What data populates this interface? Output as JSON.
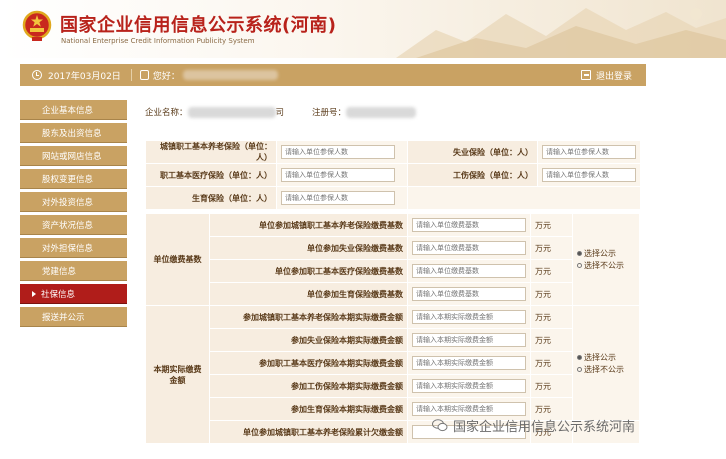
{
  "header": {
    "title": "国家企业信用信息公示系统(河南)",
    "subtitle": "National Enterprise Credit Information Publicity System"
  },
  "topbar": {
    "date": "2017年03月02日",
    "greeting": "您好：",
    "logout_label": "退出登录"
  },
  "sidebar": {
    "items": [
      {
        "label": "企业基本信息",
        "active": false
      },
      {
        "label": "股东及出资信息",
        "active": false
      },
      {
        "label": "网站或网店信息",
        "active": false
      },
      {
        "label": "股权变更信息",
        "active": false
      },
      {
        "label": "对外投资信息",
        "active": false
      },
      {
        "label": "资产状况信息",
        "active": false
      },
      {
        "label": "对外担保信息",
        "active": false
      },
      {
        "label": "党建信息",
        "active": false
      },
      {
        "label": "社保信息",
        "active": true
      },
      {
        "label": "报送并公示",
        "active": false
      }
    ]
  },
  "main": {
    "company_name_label": "企业名称：",
    "company_name_suffix": "司",
    "reg_no_label": "注册号：",
    "insured": {
      "pension_label": "城镇职工基本养老保险（单位：人）",
      "pension_placeholder": "请输入单位参保人数",
      "unemployment_label": "失业保险（单位：人）",
      "unemployment_placeholder": "请输入单位参保人数",
      "medical_label": "职工基本医疗保险（单位：人）",
      "medical_placeholder": "请输入单位参保人数",
      "injury_label": "工伤保险（单位：人）",
      "injury_placeholder": "请输入单位参保人数",
      "maternity_label": "生育保险（单位：人）",
      "maternity_placeholder": "请输入单位参保人数"
    },
    "base_group": {
      "label": "单位缴费基数",
      "rows": [
        {
          "label": "单位参加城镇职工基本养老保险缴费基数",
          "placeholder": "请输入单位缴费基数",
          "unit": "万元"
        },
        {
          "label": "单位参加失业保险缴费基数",
          "placeholder": "请输入单位缴费基数",
          "unit": "万元"
        },
        {
          "label": "单位参加职工基本医疗保险缴费基数",
          "placeholder": "请输入单位缴费基数",
          "unit": "万元"
        },
        {
          "label": "单位参加生育保险缴费基数",
          "placeholder": "请输入单位缴费基数",
          "unit": "万元"
        }
      ],
      "radio_public": "选择公示",
      "radio_private": "选择不公示"
    },
    "paid_group": {
      "label": "本期实际缴费金额",
      "rows": [
        {
          "label": "参加城镇职工基本养老保险本期实际缴费金额",
          "placeholder": "请输入本期实际缴费金额",
          "unit": "万元"
        },
        {
          "label": "参加失业保险本期实际缴费金额",
          "placeholder": "请输入本期实际缴费金额",
          "unit": "万元"
        },
        {
          "label": "参加职工基本医疗保险本期实际缴费金额",
          "placeholder": "请输入本期实际缴费金额",
          "unit": "万元"
        },
        {
          "label": "参加工伤保险本期实际缴费金额",
          "placeholder": "请输入本期实际缴费金额",
          "unit": "万元"
        },
        {
          "label": "参加生育保险本期实际缴费金额",
          "placeholder": "请输入本期实际缴费金额",
          "unit": "万元"
        },
        {
          "label": "单位参加城镇职工基本养老保险累计欠缴金额",
          "placeholder": "",
          "unit": "万元"
        }
      ],
      "radio_public": "选择公示",
      "radio_private": "选择不公示"
    }
  },
  "watermark": {
    "text": "国家企业信用信息公示系统河南"
  },
  "colors": {
    "brand_red": "#b8221b",
    "bar_gold": "#c9a263",
    "active_red": "#b01d1a",
    "panel_beige": "#f7ede0"
  }
}
